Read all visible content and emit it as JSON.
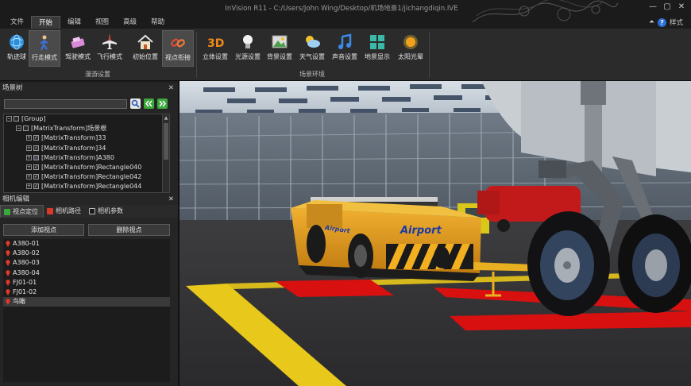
{
  "window": {
    "title": "InVision R11 - C:/Users/John Wing/Desktop/机场地景1/jichangdiqin.IVE",
    "controls": [
      "—",
      "▢",
      "✕"
    ]
  },
  "menu": [
    "文件",
    "开始",
    "编辑",
    "视图",
    "高级",
    "帮助"
  ],
  "style_label": "样式",
  "ribbon": {
    "tour_group": "漫游设置",
    "scene_group": "场景环境",
    "buttons": [
      "轨迹球",
      "行走模式",
      "驾驶模式",
      "飞行模式",
      "初始位置",
      "视点衔接",
      "立体设置",
      "光源设置",
      "背景设置",
      "天气设置",
      "声音设置",
      "地景显示",
      "太阳光晕"
    ]
  },
  "scene_tree": {
    "title": "场景树",
    "rows": [
      "[Group]",
      "[MatrixTransform]场景根",
      "[MatrixTransform]33",
      "[MatrixTransform]34",
      "[MatrixTransform]A380",
      "[MatrixTransform]Rectangle040",
      "[MatrixTransform]Rectangle042",
      "[MatrixTransform]Rectangle044"
    ]
  },
  "camera": {
    "title": "相机编辑",
    "tabs": [
      "视点定位",
      "相机路径",
      "相机参数"
    ],
    "add_button": "添加视点",
    "delete_button": "删除视点",
    "viewpoints": [
      "A380-01",
      "A380-02",
      "A380-03",
      "A380-04",
      "FJ01-01",
      "FJ01-02",
      "鸟瞰"
    ]
  },
  "scene_text": {
    "tug_label": "Airport",
    "tug_label_2": "Airport"
  },
  "colors": {
    "accent": "#3a3a3a",
    "tug_yellow": "#e8a21a",
    "marking_red": "#e01010",
    "marking_yellow": "#f2d21b"
  }
}
